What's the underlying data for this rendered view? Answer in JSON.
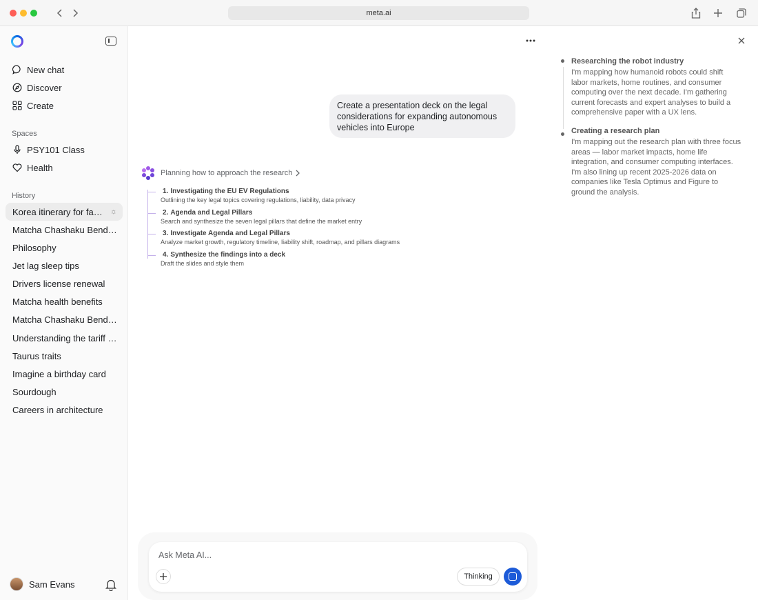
{
  "browser": {
    "url": "meta.ai"
  },
  "sidebar": {
    "nav": [
      {
        "label": "New chat",
        "icon": "chat-bubble-icon"
      },
      {
        "label": "Discover",
        "icon": "compass-icon"
      },
      {
        "label": "Create",
        "icon": "grid-icon"
      }
    ],
    "spaces_label": "Spaces",
    "spaces": [
      {
        "label": "PSY101 Class",
        "icon": "microphone-icon"
      },
      {
        "label": "Health",
        "icon": "heart-icon"
      }
    ],
    "history_label": "History",
    "history": [
      "Korea itinerary for family",
      "Matcha Chashaku Bend Purpose",
      "Philosophy",
      "Jet lag sleep tips",
      "Drivers license renewal",
      "Matcha health benefits",
      "Matcha Chashaku Bend Purpose",
      "Understanding the tariff situation",
      "Taurus traits",
      "Imagine a birthday card",
      "Sourdough",
      "Careers in architecture"
    ],
    "user_name": "Sam Evans"
  },
  "chat": {
    "user_message": "Create a presentation deck on the legal considerations for expanding autonomous vehicles into Europe",
    "planning_label": "Planning how to approach the research",
    "steps": [
      {
        "num": "1.",
        "title": "Investigating the EU EV Regulations",
        "sub": "Outlining the key legal topics covering regulations, liability, data privacy"
      },
      {
        "num": "2.",
        "title": "Agenda and Legal Pillars",
        "sub": "Search and synthesize the seven legal pillars that define the market entry"
      },
      {
        "num": "3.",
        "title": "Investigate Agenda and Legal Pillars",
        "sub": "Analyze market growth, regulatory timeline, liability shift, roadmap, and pillars diagrams"
      },
      {
        "num": "4.",
        "title": "Synthesize the findings into a deck",
        "sub": "Draft the slides and style them"
      }
    ]
  },
  "panel": {
    "items": [
      {
        "title": "Researching the robot industry",
        "body": "I'm mapping how humanoid robots could shift labor markets, home routines, and consumer computing over the next decade. I'm gathering current forecasts and expert analyses to build a comprehensive paper with a UX lens."
      },
      {
        "title": "Creating a research plan",
        "body": "I'm mapping out the research plan with three focus areas — labor market impacts, home life integration, and consumer computing interfaces. I'm also lining up recent 2025-2026 data on companies like Tesla Optimus and Figure to ground the analysis."
      }
    ]
  },
  "composer": {
    "placeholder": "Ask Meta AI...",
    "thinking_label": "Thinking"
  },
  "colors": {
    "accent": "#1d5bd8",
    "step_line": "#c4b1ea"
  }
}
